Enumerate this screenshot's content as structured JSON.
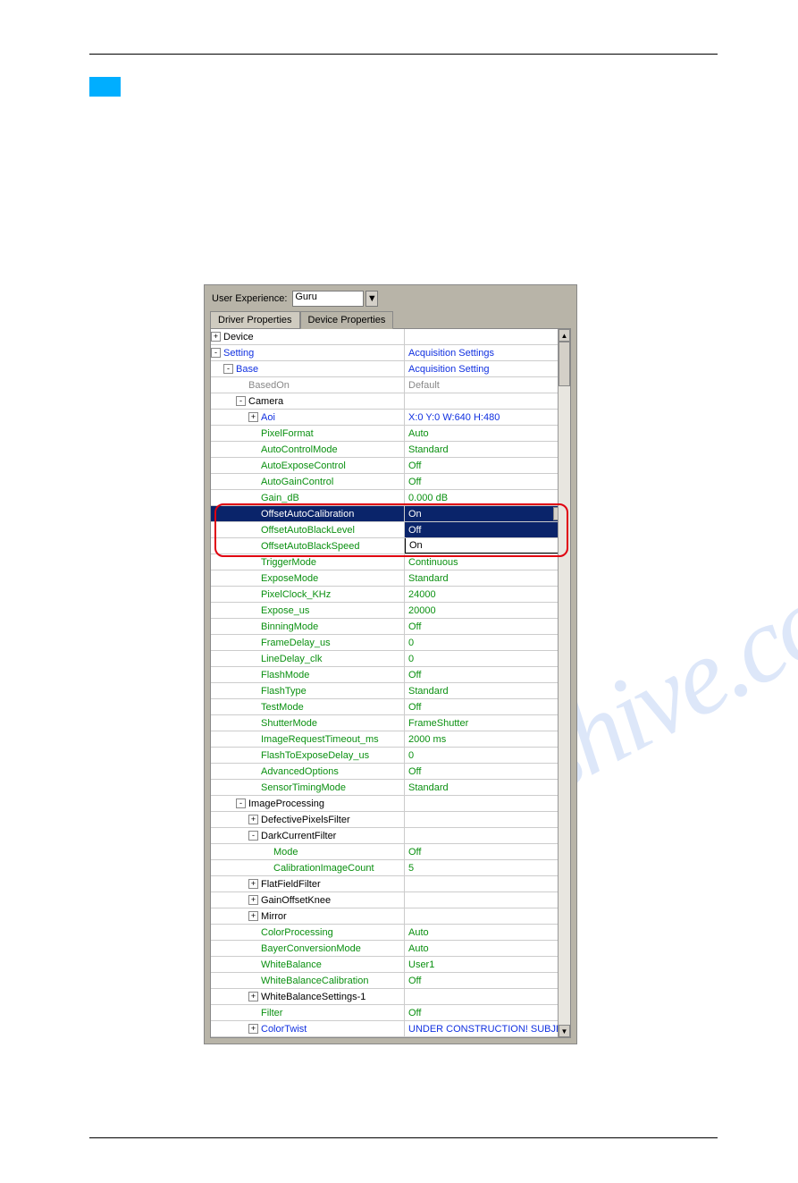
{
  "ux": {
    "label": "User Experience:",
    "value": "Guru"
  },
  "tabs": {
    "driver": "Driver Properties",
    "device": "Device Properties"
  },
  "rows": [
    {
      "indent": 0,
      "pm": "+",
      "name": "Device",
      "ncls": "txt-black",
      "value": "",
      "vcls": ""
    },
    {
      "indent": 0,
      "pm": "-",
      "name": "Setting",
      "ncls": "txt-blue",
      "value": "Acquisition Settings",
      "vcls": "val-blue"
    },
    {
      "indent": 1,
      "pm": "-",
      "name": "Base",
      "ncls": "txt-blue",
      "value": "Acquisition Setting",
      "vcls": "val-blue"
    },
    {
      "indent": 3,
      "pm": "",
      "name": "BasedOn",
      "ncls": "txt-gray",
      "value": "Default",
      "vcls": "val-gray"
    },
    {
      "indent": 2,
      "pm": "-",
      "name": "Camera",
      "ncls": "txt-black",
      "value": "",
      "vcls": ""
    },
    {
      "indent": 3,
      "pm": "+",
      "name": "Aoi",
      "ncls": "txt-blue",
      "value": "X:0 Y:0 W:640 H:480",
      "vcls": "val-blue"
    },
    {
      "indent": 4,
      "pm": "",
      "name": "PixelFormat",
      "ncls": "txt-green",
      "value": "Auto",
      "vcls": ""
    },
    {
      "indent": 4,
      "pm": "",
      "name": "AutoControlMode",
      "ncls": "txt-green",
      "value": "Standard",
      "vcls": ""
    },
    {
      "indent": 4,
      "pm": "",
      "name": "AutoExposeControl",
      "ncls": "txt-green",
      "value": "Off",
      "vcls": ""
    },
    {
      "indent": 4,
      "pm": "",
      "name": "AutoGainControl",
      "ncls": "txt-green",
      "value": "Off",
      "vcls": ""
    },
    {
      "indent": 4,
      "pm": "",
      "name": "Gain_dB",
      "ncls": "txt-green",
      "value": "0.000 dB",
      "vcls": ""
    },
    {
      "indent": 4,
      "pm": "",
      "name": "OffsetAutoCalibration",
      "ncls": "txt-green",
      "value": "On",
      "vcls": "",
      "sel": true,
      "dd": true
    },
    {
      "indent": 4,
      "pm": "",
      "name": "OffsetAutoBlackLevel",
      "ncls": "txt-green",
      "value": "Off",
      "vcls": "",
      "dropdown_opt": true
    },
    {
      "indent": 4,
      "pm": "",
      "name": "OffsetAutoBlackSpeed",
      "ncls": "txt-green",
      "value": "On",
      "vcls": "val-black",
      "dropdown_opt": true
    },
    {
      "indent": 4,
      "pm": "",
      "name": "TriggerMode",
      "ncls": "txt-green",
      "value": "Continuous",
      "vcls": ""
    },
    {
      "indent": 4,
      "pm": "",
      "name": "ExposeMode",
      "ncls": "txt-green",
      "value": "Standard",
      "vcls": ""
    },
    {
      "indent": 4,
      "pm": "",
      "name": "PixelClock_KHz",
      "ncls": "txt-green",
      "value": "24000",
      "vcls": ""
    },
    {
      "indent": 4,
      "pm": "",
      "name": "Expose_us",
      "ncls": "txt-green",
      "value": "20000",
      "vcls": ""
    },
    {
      "indent": 4,
      "pm": "",
      "name": "BinningMode",
      "ncls": "txt-green",
      "value": "Off",
      "vcls": ""
    },
    {
      "indent": 4,
      "pm": "",
      "name": "FrameDelay_us",
      "ncls": "txt-green",
      "value": "0",
      "vcls": ""
    },
    {
      "indent": 4,
      "pm": "",
      "name": "LineDelay_clk",
      "ncls": "txt-green",
      "value": "0",
      "vcls": ""
    },
    {
      "indent": 4,
      "pm": "",
      "name": "FlashMode",
      "ncls": "txt-green",
      "value": "Off",
      "vcls": ""
    },
    {
      "indent": 4,
      "pm": "",
      "name": "FlashType",
      "ncls": "txt-green",
      "value": "Standard",
      "vcls": ""
    },
    {
      "indent": 4,
      "pm": "",
      "name": "TestMode",
      "ncls": "txt-green",
      "value": "Off",
      "vcls": ""
    },
    {
      "indent": 4,
      "pm": "",
      "name": "ShutterMode",
      "ncls": "txt-green",
      "value": "FrameShutter",
      "vcls": ""
    },
    {
      "indent": 4,
      "pm": "",
      "name": "ImageRequestTimeout_ms",
      "ncls": "txt-green",
      "value": "2000 ms",
      "vcls": ""
    },
    {
      "indent": 4,
      "pm": "",
      "name": "FlashToExposeDelay_us",
      "ncls": "txt-green",
      "value": "0",
      "vcls": ""
    },
    {
      "indent": 4,
      "pm": "",
      "name": "AdvancedOptions",
      "ncls": "txt-green",
      "value": "Off",
      "vcls": ""
    },
    {
      "indent": 4,
      "pm": "",
      "name": "SensorTimingMode",
      "ncls": "txt-green",
      "value": "Standard",
      "vcls": ""
    },
    {
      "indent": 2,
      "pm": "-",
      "name": "ImageProcessing",
      "ncls": "txt-black",
      "value": "",
      "vcls": ""
    },
    {
      "indent": 3,
      "pm": "+",
      "name": "DefectivePixelsFilter",
      "ncls": "txt-black",
      "value": "",
      "vcls": ""
    },
    {
      "indent": 3,
      "pm": "-",
      "name": "DarkCurrentFilter",
      "ncls": "txt-black",
      "value": "",
      "vcls": ""
    },
    {
      "indent": 5,
      "pm": "",
      "name": "Mode",
      "ncls": "txt-green",
      "value": "Off",
      "vcls": ""
    },
    {
      "indent": 5,
      "pm": "",
      "name": "CalibrationImageCount",
      "ncls": "txt-green",
      "value": "5",
      "vcls": ""
    },
    {
      "indent": 3,
      "pm": "+",
      "name": "FlatFieldFilter",
      "ncls": "txt-black",
      "value": "",
      "vcls": ""
    },
    {
      "indent": 3,
      "pm": "+",
      "name": "GainOffsetKnee",
      "ncls": "txt-black",
      "value": "",
      "vcls": ""
    },
    {
      "indent": 3,
      "pm": "+",
      "name": "Mirror",
      "ncls": "txt-black",
      "value": "",
      "vcls": ""
    },
    {
      "indent": 4,
      "pm": "",
      "name": "ColorProcessing",
      "ncls": "txt-green",
      "value": "Auto",
      "vcls": ""
    },
    {
      "indent": 4,
      "pm": "",
      "name": "BayerConversionMode",
      "ncls": "txt-green",
      "value": "Auto",
      "vcls": ""
    },
    {
      "indent": 4,
      "pm": "",
      "name": "WhiteBalance",
      "ncls": "txt-green",
      "value": "User1",
      "vcls": ""
    },
    {
      "indent": 4,
      "pm": "",
      "name": "WhiteBalanceCalibration",
      "ncls": "txt-green",
      "value": "Off",
      "vcls": ""
    },
    {
      "indent": 3,
      "pm": "+",
      "name": "WhiteBalanceSettings-1",
      "ncls": "txt-black",
      "value": "",
      "vcls": ""
    },
    {
      "indent": 4,
      "pm": "",
      "name": "Filter",
      "ncls": "txt-green",
      "value": "Off",
      "vcls": ""
    },
    {
      "indent": 3,
      "pm": "+",
      "name": "ColorTwist",
      "ncls": "txt-blue",
      "value": "UNDER CONSTRUCTION! SUBJECT TO",
      "vcls": "val-blue"
    }
  ],
  "watermark": "manualshive.com"
}
